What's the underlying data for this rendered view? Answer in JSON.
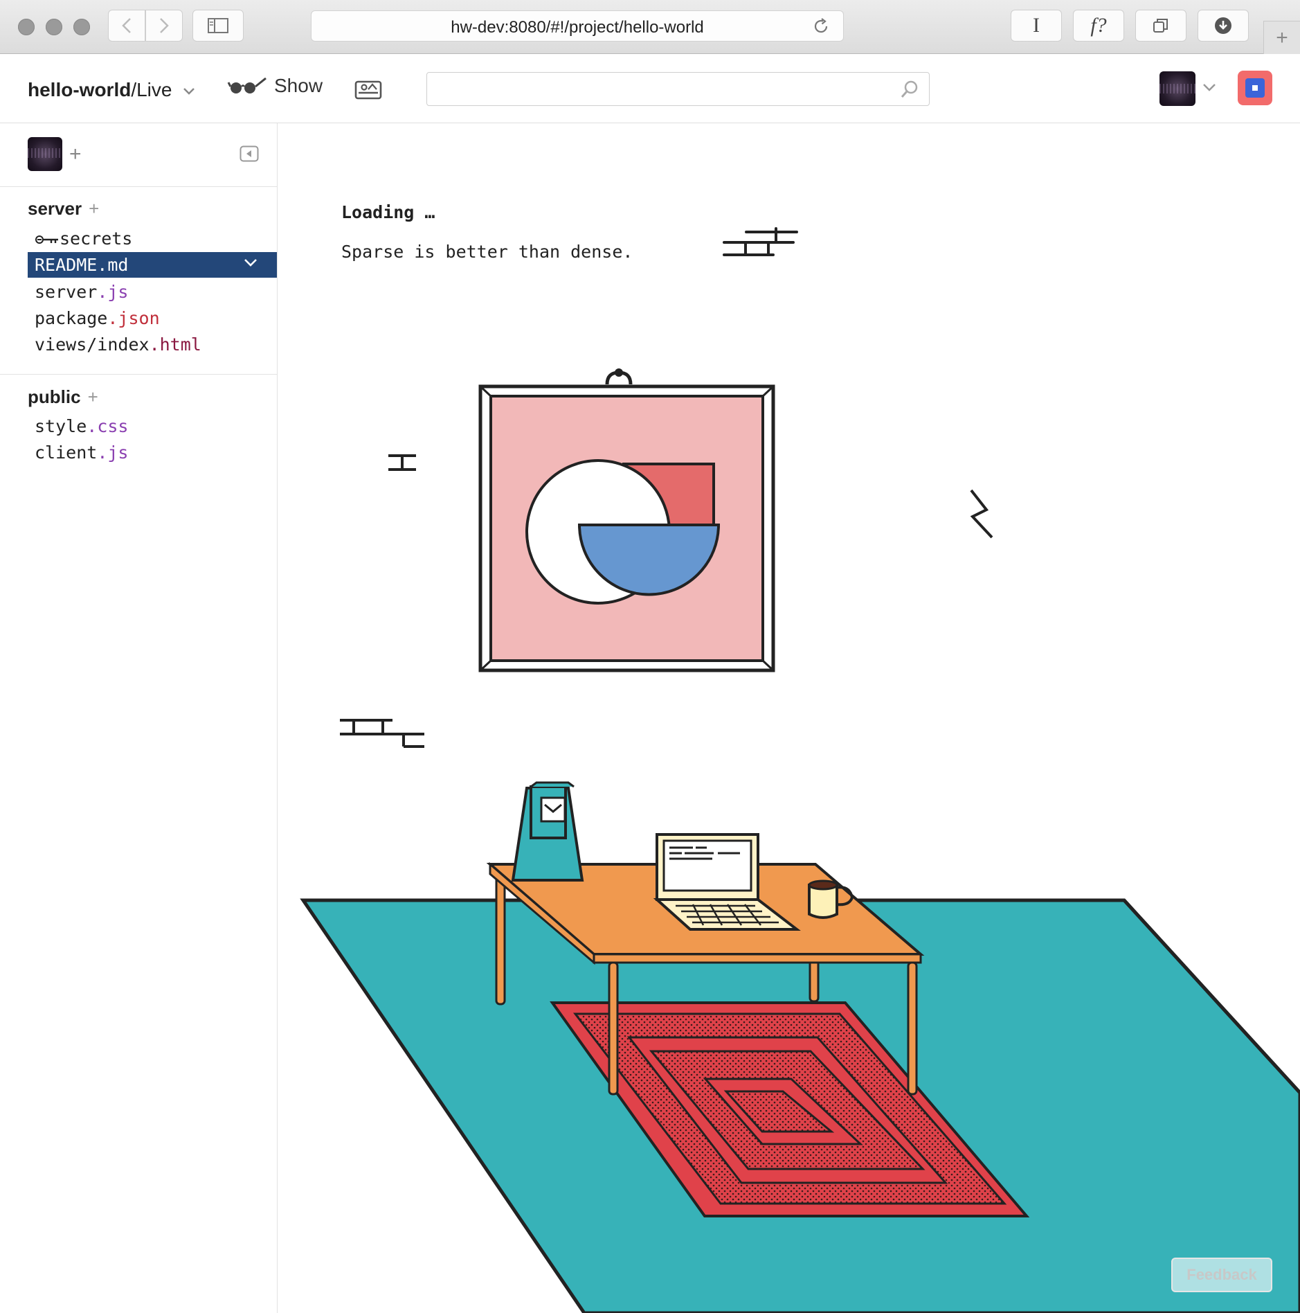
{
  "browser": {
    "url": "hw-dev:8080/#!/project/hello-world",
    "reader_label": "I",
    "font_label": "f?",
    "icons": [
      "back-icon",
      "forward-icon",
      "sidebar-icon",
      "reload-icon",
      "tabs-icon",
      "download-icon",
      "new-tab-icon"
    ]
  },
  "header": {
    "project_name": "hello-world",
    "project_suffix": "/Live",
    "show_label": "Show",
    "search_placeholder": ""
  },
  "sidebar": {
    "sections": [
      {
        "title": "server",
        "files": [
          {
            "base": "secrets",
            "ext": "",
            "icon": "key-icon"
          },
          {
            "base": "README.md",
            "ext": "",
            "selected": true
          },
          {
            "base": "server",
            "ext": ".js"
          },
          {
            "base": "package",
            "ext": ".json"
          },
          {
            "base": "views/index",
            "ext": ".html"
          }
        ]
      },
      {
        "title": "public",
        "files": [
          {
            "base": "style",
            "ext": ".css"
          },
          {
            "base": "client",
            "ext": ".js"
          }
        ]
      }
    ]
  },
  "main": {
    "loading": "Loading …",
    "tagline": "Sparse is better than dense."
  },
  "feedback_label": "Feedback",
  "colors": {
    "accent_selected": "#234779",
    "teal_floor": "#37b2b8",
    "rug_red": "#e0424a",
    "table_orange": "#f0994f",
    "frame_pink": "#f2b8b8",
    "stop_red": "#f26b6b",
    "stop_blue": "#3b64d8"
  }
}
